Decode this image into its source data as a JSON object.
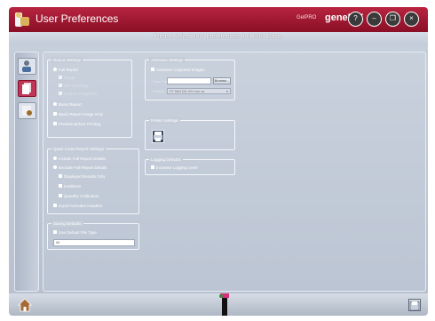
{
  "window": {
    "title": "User Preferences",
    "brand_small": "GelPRO",
    "brand": "genePIX",
    "buttons": [
      {
        "name": "help-button",
        "icon": "question-icon",
        "glyph": "?"
      },
      {
        "name": "minimize-button",
        "icon": "minimize-icon",
        "glyph": "–"
      },
      {
        "name": "restore-button",
        "icon": "restore-icon",
        "glyph": "❐"
      },
      {
        "name": "close-button",
        "icon": "close-icon",
        "glyph": "×"
      }
    ]
  },
  "instruction": "Please select your preferences and click Save.",
  "sidebar": {
    "items": [
      {
        "name": "users-icon",
        "active": false
      },
      {
        "name": "documents-icon",
        "active": true
      },
      {
        "name": "settings-icon",
        "active": false
      }
    ]
  },
  "report_settings": {
    "title": "Report Settings",
    "full_report": "Full Report",
    "sub1": "Image",
    "sub2": "Gel Summary",
    "sub3": "Custom Properties",
    "basic_report": "Basic Report",
    "basic_image_only": "Basic Report Image Only",
    "preview": "Preview Before Printing"
  },
  "quick_count": {
    "title": "Quick Count Report Settings",
    "o1": "Include Full Report Details",
    "o2": "Exclude Full Report Details",
    "o3": "Displayed Results Only",
    "o4": "Incidence",
    "o5": "Quantity Calibration",
    "o6": "Export Includes Headers"
  },
  "saving": {
    "title": "Saving Defaults",
    "use_default": "Use Default File Type",
    "file_type": "tiff"
  },
  "autosave": {
    "title": "Autosave Settings",
    "option": "Autosave Captured Images",
    "save_path_label": "Save Path",
    "browse": "Browse...",
    "format_label": "Format",
    "format_value": "FF MM DD HH mm ss"
  },
  "printer": {
    "title": "Printer Settings"
  },
  "logging": {
    "title": "Logging Defaults",
    "option": "Increase Logging Level"
  },
  "colors": {
    "titlebar": "#a31a36",
    "panel": "#c3cbd8",
    "accent_active": "#c03656"
  }
}
